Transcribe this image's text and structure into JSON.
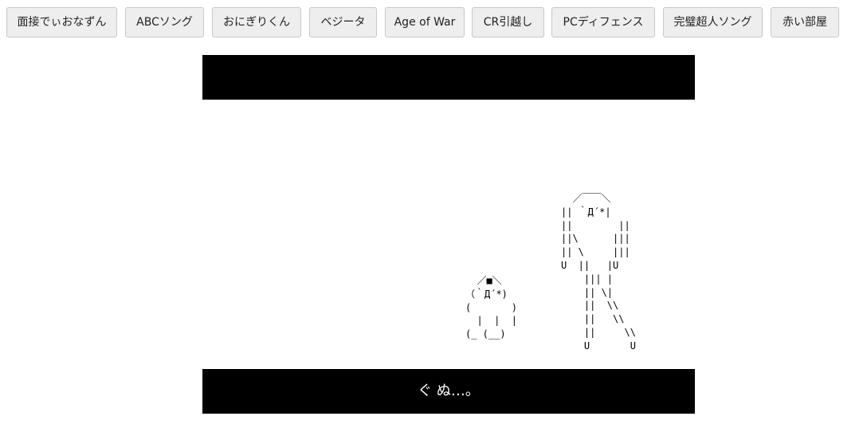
{
  "nav": {
    "buttons": [
      {
        "label": "面接でぃおなずん"
      },
      {
        "label": "ABCソング"
      },
      {
        "label": "おにぎりくん"
      },
      {
        "label": "ベジータ"
      },
      {
        "label": "Age of War"
      },
      {
        "label": "CR引越し"
      },
      {
        "label": "PCディフェンス"
      },
      {
        "label": "完璧超人ソング"
      },
      {
        "label": "赤い部屋"
      }
    ]
  },
  "stage": {
    "top_bar_text": "",
    "dialogue_text": "ぐ ぬ…。",
    "ascii_small": "  ／■＼\n（｀Д´*)\n(       )\n  |  |  |\n(_ (__)",
    "ascii_tall": "  ／￣￣＼\n|| ｀Д´*|\n||        ||\n||\\      |||\n|| \\     |||\nU  ||   |U\n    ||| |\n    || \\|\n    ||  \\\\\n    ||   \\\\\n    ||     \\\\\n    U       U"
  }
}
